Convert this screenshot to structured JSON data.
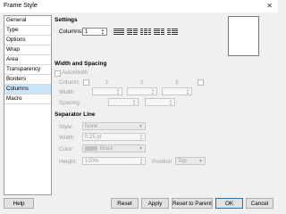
{
  "window": {
    "title": "Frame Style",
    "close_glyph": "✕"
  },
  "sidebar": {
    "items": [
      {
        "label": "General"
      },
      {
        "label": "Type"
      },
      {
        "label": "Options"
      },
      {
        "label": "Wrap"
      },
      {
        "label": "Area"
      },
      {
        "label": "Transparency"
      },
      {
        "label": "Borders"
      },
      {
        "label": "Columns",
        "selected": true
      },
      {
        "label": "Macro"
      }
    ]
  },
  "settings": {
    "heading": "Settings",
    "columns_label": "Columns:",
    "columns_value": "1",
    "preset_icons": [
      "one-column-icon",
      "two-columns-icon",
      "three-columns-icon",
      "left-wide-columns-icon",
      "right-wide-columns-icon"
    ]
  },
  "width_spacing": {
    "heading": "Width and Spacing",
    "autowidth_label": "AutoWidth",
    "column_label": "Column:",
    "col1": "1",
    "col2": "2",
    "col3": "3",
    "width_label": "Width:",
    "spacing_label": "Spacing:"
  },
  "separator": {
    "heading": "Separator Line",
    "style_label": "Style:",
    "style_value": "None",
    "width_label": "Width:",
    "width_value": "0.25 pt",
    "color_label": "Color:",
    "color_value": "Black",
    "height_label": "Height:",
    "height_value": "100%",
    "position_label": "Position",
    "position_value": "Top"
  },
  "buttons": {
    "help": "Help",
    "reset": "Reset",
    "apply": "Apply",
    "reset_parent": "Reset to Parent",
    "ok": "OK",
    "cancel": "Cancel"
  },
  "colors": {
    "selection": "#cce4f7",
    "default_button_border": "#0078d7"
  }
}
